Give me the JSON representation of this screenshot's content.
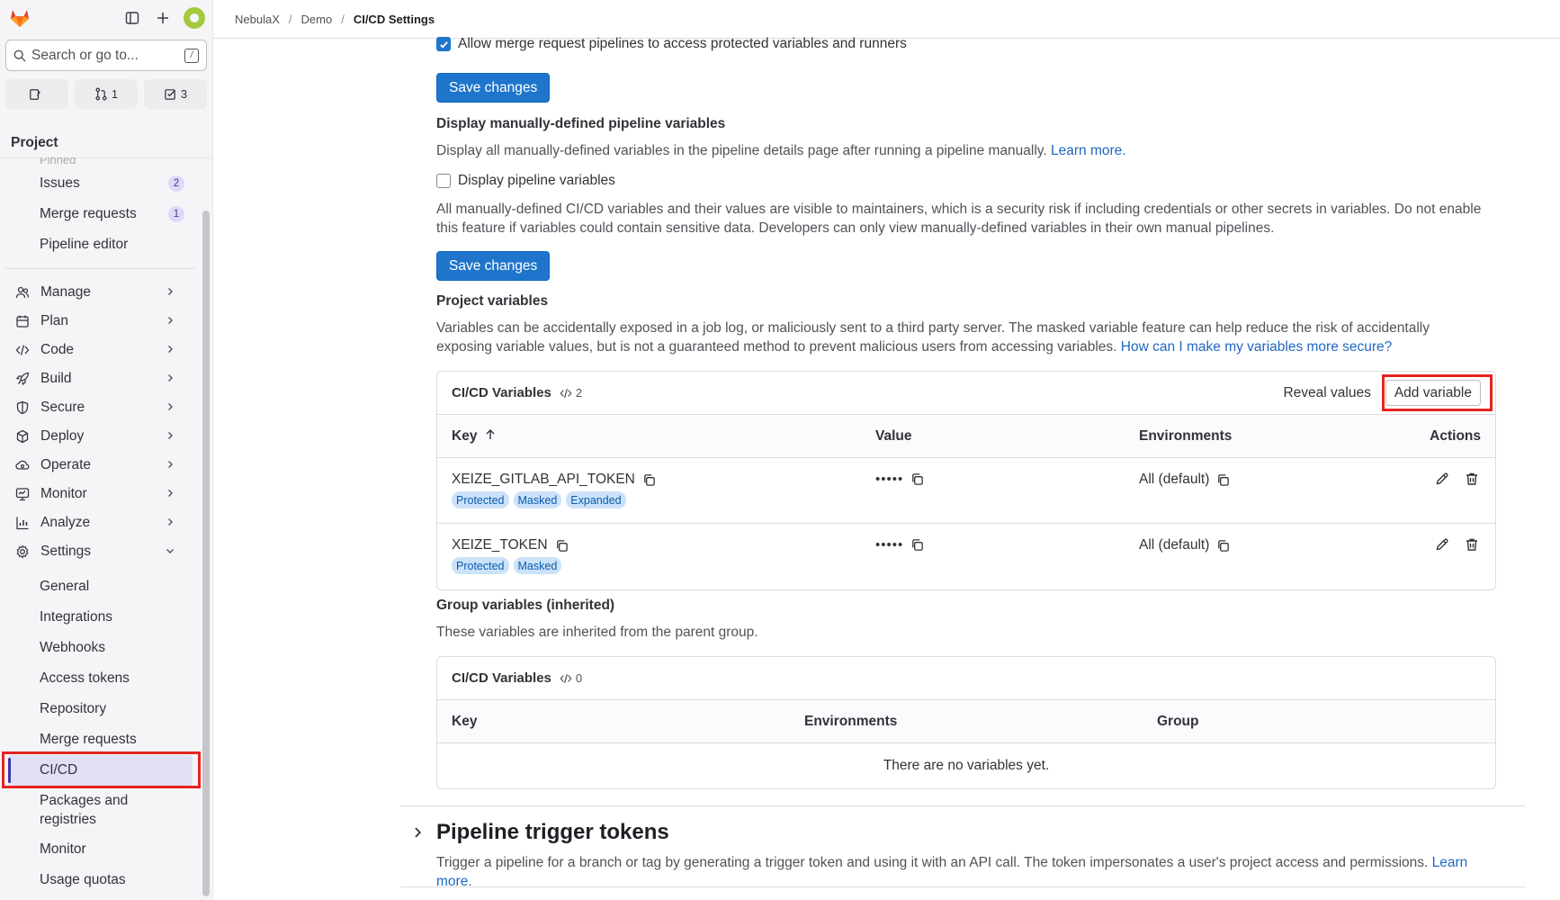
{
  "sidebar": {
    "search_placeholder": "Search or go to...",
    "search_shortcut": "/",
    "counters": [
      {
        "icon": "issues-icon",
        "count": ""
      },
      {
        "icon": "merge-request-icon",
        "count": "1"
      },
      {
        "icon": "todo-icon",
        "count": "3"
      }
    ],
    "section_title": "Project",
    "faded_item": "Pinned",
    "pinned": [
      {
        "label": "Issues",
        "badge": "2"
      },
      {
        "label": "Merge requests",
        "badge": "1"
      },
      {
        "label": "Pipeline editor",
        "badge": ""
      }
    ],
    "groups": [
      "Manage",
      "Plan",
      "Code",
      "Build",
      "Secure",
      "Deploy",
      "Operate",
      "Monitor",
      "Analyze",
      "Settings"
    ],
    "settings_items": [
      "General",
      "Integrations",
      "Webhooks",
      "Access tokens",
      "Repository",
      "Merge requests",
      "CI/CD",
      "Packages and registries",
      "Monitor",
      "Usage quotas"
    ]
  },
  "breadcrumb": [
    "NebulaX",
    "Demo",
    "CI/CD Settings"
  ],
  "main": {
    "allow_mr_pipelines": "Allow merge request pipelines to access protected variables and runners",
    "save_changes": "Save changes",
    "display_vars_title": "Display manually-defined pipeline variables",
    "display_vars_desc": "Display all manually-defined variables in the pipeline details page after running a pipeline manually.",
    "learn_more": "Learn more.",
    "display_vars_checkbox": "Display pipeline variables",
    "display_vars_warning": "All manually-defined CI/CD variables and their values are visible to maintainers, which is a security risk if including credentials or other secrets in variables. Do not enable this feature if variables could contain sensitive data. Developers can only view manually-defined variables in their own manual pipelines.",
    "project_vars_title": "Project variables",
    "project_vars_desc": "Variables can be accidentally exposed in a job log, or maliciously sent to a third party server. The masked variable feature can help reduce the risk of accidentally exposing variable values, but is not a guaranteed method to prevent malicious users from accessing variables.",
    "secure_link": "How can I make my variables more secure?",
    "project_card": {
      "title": "CI/CD Variables",
      "count": "2",
      "reveal": "Reveal values",
      "add": "Add variable",
      "headers": {
        "key": "Key",
        "value": "Value",
        "env": "Environments",
        "actions": "Actions"
      },
      "rows": [
        {
          "key": "XEIZE_GITLAB_API_TOKEN",
          "value": "•••••",
          "env": "All (default)",
          "tags": [
            "Protected",
            "Masked",
            "Expanded"
          ]
        },
        {
          "key": "XEIZE_TOKEN",
          "value": "•••••",
          "env": "All (default)",
          "tags": [
            "Protected",
            "Masked"
          ]
        }
      ]
    },
    "group_vars_title": "Group variables (inherited)",
    "group_vars_desc": "These variables are inherited from the parent group.",
    "group_card": {
      "title": "CI/CD Variables",
      "count": "0",
      "headers": {
        "key": "Key",
        "env": "Environments",
        "group": "Group"
      },
      "empty": "There are no variables yet."
    },
    "trigger_title": "Pipeline trigger tokens",
    "trigger_desc": "Trigger a pipeline for a branch or tag by generating a trigger token and using it with an API call. The token impersonates a user's project access and permissions.",
    "trigger_learn_more": "Learn more."
  },
  "colors": {
    "primary": "#1f75cb",
    "highlight": "#e8231f",
    "tag_bg": "#cbe2f9",
    "active_nav": "#e1dff3"
  }
}
